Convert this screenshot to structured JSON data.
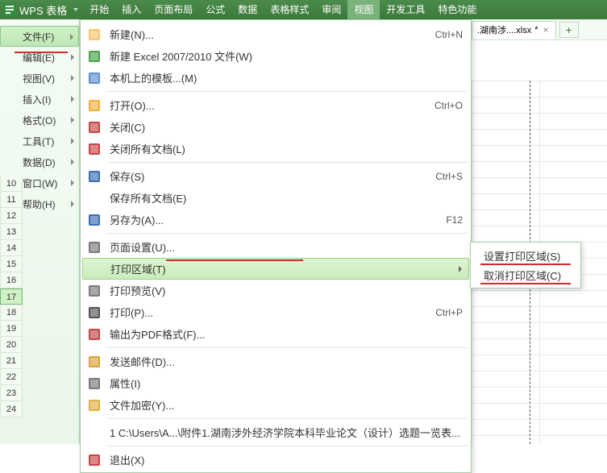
{
  "app": {
    "title": "WPS 表格"
  },
  "topmenu": [
    "开始",
    "插入",
    "页面布局",
    "公式",
    "数据",
    "表格样式",
    "审阅",
    "视图",
    "开发工具",
    "特色功能"
  ],
  "activeTopMenuIndex": 7,
  "sidebar": {
    "items": [
      {
        "label": "文件(F)",
        "active": true
      },
      {
        "label": "编辑(E)"
      },
      {
        "label": "视图(V)"
      },
      {
        "label": "插入(I)"
      },
      {
        "label": "格式(O)"
      },
      {
        "label": "工具(T)"
      },
      {
        "label": "数据(D)"
      },
      {
        "label": "窗口(W)"
      },
      {
        "label": "帮助(H)",
        "icon": "help"
      }
    ]
  },
  "tab": {
    "name": ".湖南涉....xlsx",
    "star": "*"
  },
  "menu": {
    "items": [
      {
        "icon": "new",
        "label": "新建(N)...",
        "shortcut": "Ctrl+N"
      },
      {
        "icon": "newx",
        "label": "新建 Excel 2007/2010 文件(W)"
      },
      {
        "icon": "tpl",
        "label": "本机上的模板...(M)"
      },
      {
        "sep": true
      },
      {
        "icon": "open",
        "label": "打开(O)...",
        "shortcut": "Ctrl+O"
      },
      {
        "icon": "close",
        "label": "关闭(C)"
      },
      {
        "icon": "closeall",
        "label": "关闭所有文档(L)"
      },
      {
        "sep": true
      },
      {
        "icon": "save",
        "label": "保存(S)",
        "shortcut": "Ctrl+S"
      },
      {
        "icon": "",
        "label": "保存所有文档(E)"
      },
      {
        "icon": "saveas",
        "label": "另存为(A)...",
        "shortcut": "F12"
      },
      {
        "sep": true
      },
      {
        "icon": "pgsetup",
        "label": "页面设置(U)..."
      },
      {
        "icon": "",
        "label": "打印区域(T)",
        "submenu": true,
        "highlight": true
      },
      {
        "icon": "preview",
        "label": "打印预览(V)"
      },
      {
        "icon": "print",
        "label": "打印(P)...",
        "shortcut": "Ctrl+P"
      },
      {
        "icon": "pdf",
        "label": "输出为PDF格式(F)..."
      },
      {
        "sep": true
      },
      {
        "icon": "mail",
        "label": "发送邮件(D)..."
      },
      {
        "icon": "props",
        "label": "属性(I)"
      },
      {
        "icon": "encrypt",
        "label": "文件加密(Y)..."
      },
      {
        "sep": true
      },
      {
        "icon": "",
        "label": "1 C:\\Users\\A...\\附件1.湖南涉外经济学院本科毕业论文（设计）选题一览表..."
      },
      {
        "sep": true
      },
      {
        "icon": "exit",
        "label": "退出(X)"
      }
    ]
  },
  "submenu": {
    "items": [
      {
        "label": "设置打印区域(S)"
      },
      {
        "label": "取消打印区域(C)"
      }
    ]
  },
  "rows": [
    "10",
    "11",
    "12",
    "13",
    "14",
    "15",
    "16",
    "17",
    "18",
    "19",
    "20",
    "21",
    "22",
    "23",
    "24"
  ]
}
